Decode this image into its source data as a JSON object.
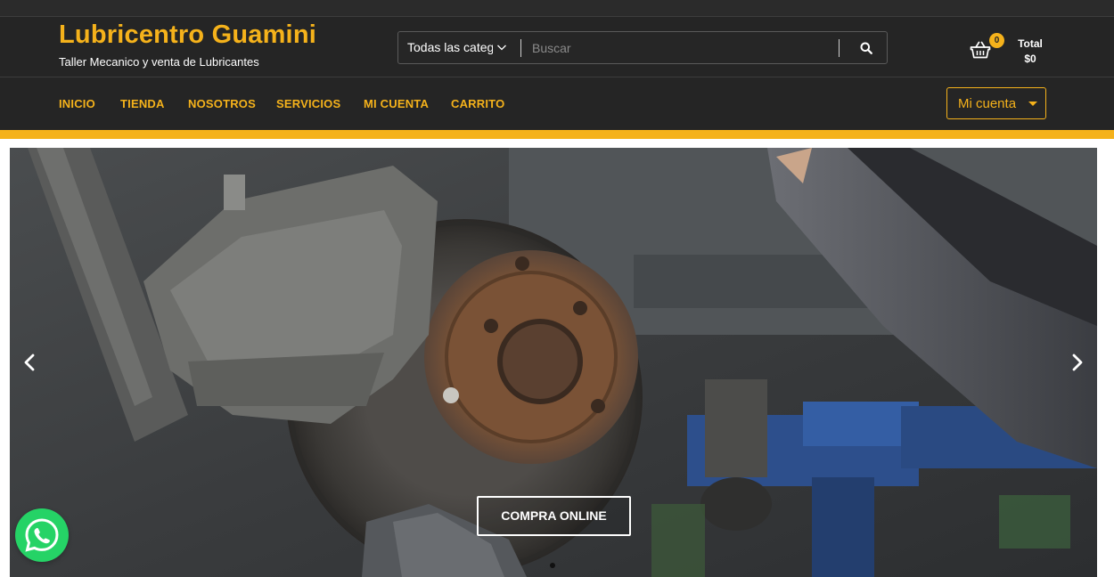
{
  "header": {
    "title": "Lubricentro Guamini",
    "subtitle": "Taller Mecanico y venta de Lubricantes"
  },
  "search": {
    "category_value": "Todas las categ",
    "placeholder": "Buscar",
    "icon": "search-icon"
  },
  "cart": {
    "count": "0",
    "total_label": "Total",
    "total_value": "$0",
    "icon": "basket-icon"
  },
  "nav": {
    "items": [
      {
        "label": "INICIO"
      },
      {
        "label": "TIENDA"
      },
      {
        "label": "NOSOTROS"
      },
      {
        "label": "SERVICIOS"
      },
      {
        "label": "MI CUENTA"
      },
      {
        "label": "CARRITO"
      }
    ],
    "account_button": "Mi cuenta"
  },
  "slider": {
    "cta_label": "COMPRA ONLINE",
    "prev_icon": "chevron-left-icon",
    "next_icon": "chevron-right-icon",
    "active_slide": 1
  },
  "colors": {
    "brand": "#f5b21b",
    "header_bg": "#252525",
    "whatsapp": "#25d366"
  }
}
